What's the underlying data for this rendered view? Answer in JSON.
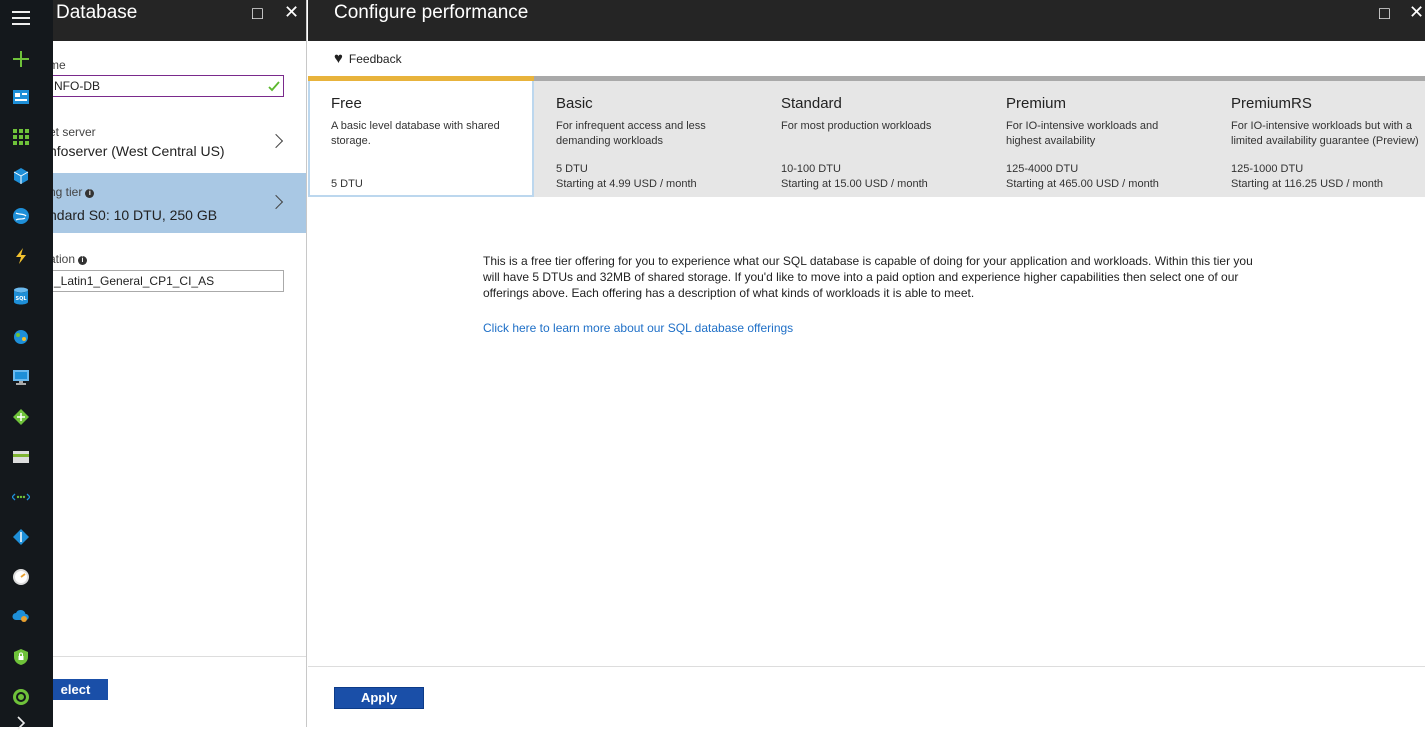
{
  "nav_rail": {
    "icons": [
      "hamburger-menu-icon",
      "new-plus-icon",
      "dashboard-icon",
      "all-resources-icon",
      "cube-icon",
      "globe-icon",
      "lightning-icon",
      "sql-database-icon",
      "network-globe-icon",
      "virtual-machine-icon",
      "diamond-icon",
      "storage-icon",
      "dots-connection-icon",
      "directory-icon",
      "gauge-icon",
      "cloud-icon",
      "shield-icon",
      "circle-check-icon",
      "chevron-right-icon"
    ],
    "sql_icon_text": "SQL"
  },
  "db_blade": {
    "title": "Database",
    "name_label": "me",
    "name_value": "NFO-DB",
    "server_label": "et server",
    "server_value": "nfoserver (West Central US)",
    "tier_label": "ng tier",
    "tier_value": "ndard S0: 10 DTU, 250 GB",
    "collation_label": "ation",
    "collation_value": "_Latin1_General_CP1_CI_AS",
    "select_label": "elect",
    "maximize_icon": "□",
    "close_icon": "✕"
  },
  "perf_blade": {
    "title": "Configure performance",
    "feedback_label": "Feedback",
    "tiers": [
      {
        "name": "Free",
        "desc": "A basic level database with shared storage.",
        "dtu": "5 DTU",
        "price": ""
      },
      {
        "name": "Basic",
        "desc": "For infrequent access and less demanding workloads",
        "dtu": "5 DTU",
        "price": "Starting at 4.99 USD / month"
      },
      {
        "name": "Standard",
        "desc": "For most production workloads",
        "dtu": "10-100 DTU",
        "price": "Starting at 15.00 USD / month"
      },
      {
        "name": "Premium",
        "desc": "For IO-intensive workloads and highest availability",
        "dtu": "125-4000 DTU",
        "price": "Starting at 465.00 USD / month"
      },
      {
        "name": "PremiumRS",
        "desc": "For IO-intensive workloads but with a limited availability guarantee (Preview)",
        "dtu": "125-1000 DTU",
        "price": "Starting at 116.25 USD / month"
      }
    ],
    "selected_tier": "Free",
    "description": "This is a free tier offering for you to experience what our SQL database is capable of doing for your application and workloads. Within this tier you will have 5 DTUs and 32MB of shared storage. If you'd like to move into a paid option and experience higher capabilities then select one of our offerings above. Each offering has a description of what kinds of workloads it is able to meet.",
    "learn_more_link": "Click here to learn more about our SQL database offerings",
    "apply_label": "Apply"
  },
  "colors": {
    "accent_blue": "#1a4fa8",
    "selected_row": "#a9c8e4",
    "selected_tier_bar": "#e8b33c",
    "link": "#1e6fc7",
    "valid_check": "#5cb82e"
  }
}
